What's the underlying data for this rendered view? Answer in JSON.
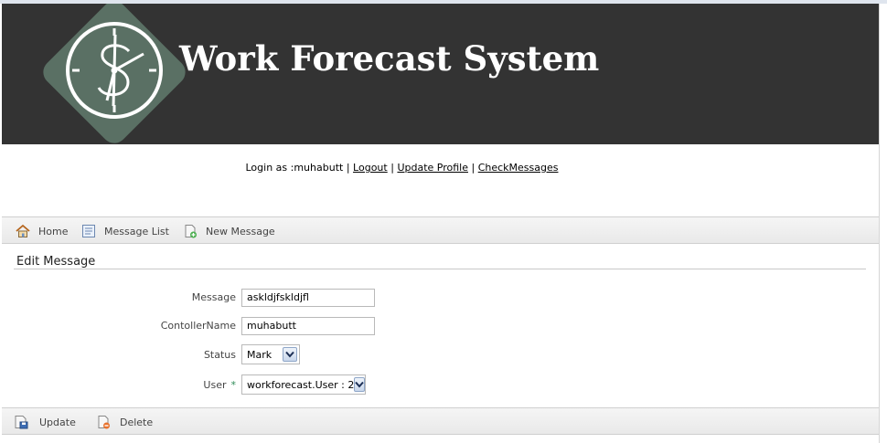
{
  "header": {
    "title": "Work Forecast System",
    "logo_icon": "clock-dollar-logo-icon",
    "background_color": "#333333"
  },
  "login_bar": {
    "prefix": "Login as :muhabutt",
    "separator": "|",
    "logout_label": "Logout",
    "update_profile_label": "Update Profile",
    "check_messages_label": "CheckMessages"
  },
  "nav_toolbar": {
    "items": [
      {
        "label": "Home",
        "icon": "home-icon"
      },
      {
        "label": "Message List",
        "icon": "message-list-icon"
      },
      {
        "label": "New Message",
        "icon": "new-message-icon"
      }
    ]
  },
  "form": {
    "section_title": "Edit Message",
    "fields": {
      "message": {
        "label": "Message",
        "value": "askldjfskldjfl"
      },
      "controller_name": {
        "label": "ContollerName",
        "value": "muhabutt"
      },
      "status": {
        "label": "Status",
        "selected": "Mark"
      },
      "user": {
        "label": "User",
        "required_mark": "*",
        "selected": "workforecast.User : 2"
      }
    }
  },
  "action_toolbar": {
    "items": [
      {
        "label": "Update",
        "icon": "update-icon"
      },
      {
        "label": "Delete",
        "icon": "delete-icon"
      }
    ]
  },
  "colors": {
    "header_bg": "#333333",
    "logo_diamond": "#5a7064",
    "toolbar_bg": "#ececec",
    "required_mark": "#2e8b57"
  }
}
